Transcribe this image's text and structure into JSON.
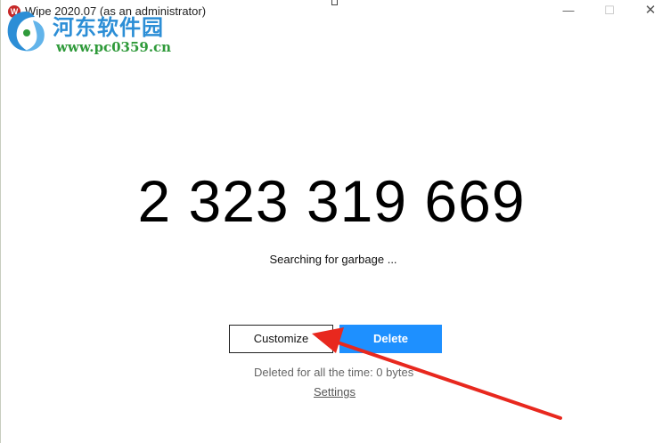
{
  "window": {
    "title": "Wipe 2020.07  (as an administrator)",
    "app_icon_glyph": "W",
    "minimize_glyph": "—",
    "maximize_glyph": "☐",
    "close_glyph": "✕"
  },
  "watermark": {
    "site_name_cn": "河东软件园",
    "site_url": "www.pc0359.cn"
  },
  "main": {
    "garbage_count": "2 323 319 669",
    "status": "Searching for garbage ...",
    "customize_label": "Customize",
    "delete_label": "Delete",
    "deleted_total": "Deleted for all the time: 0 bytes",
    "settings_label": "Settings"
  },
  "colors": {
    "delete_button": "#1e90ff",
    "annotation_arrow": "#e8281e",
    "watermark_blue": "#2c8ed6",
    "watermark_green": "#2f9a3a"
  },
  "icons": {
    "app": "wipe-app-icon",
    "watermark_logo": "pc0359-logo-icon",
    "annotation": "red-arrow-icon"
  }
}
